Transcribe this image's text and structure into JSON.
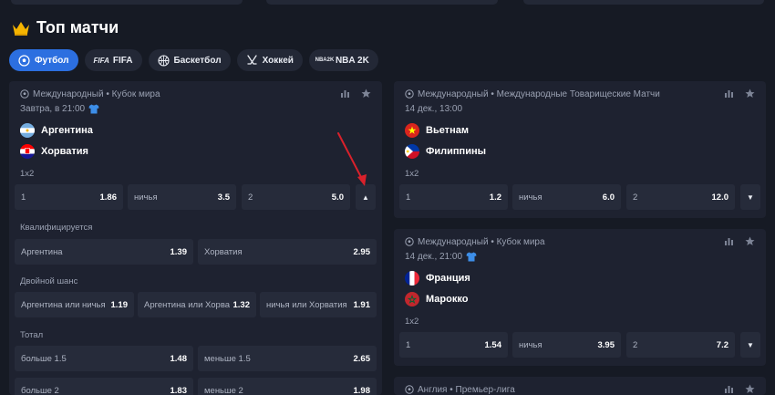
{
  "page": {
    "title": "Топ матчи"
  },
  "sport_tabs": [
    {
      "label": "Футбол",
      "icon": "soccer-ball-icon",
      "active": true
    },
    {
      "label": "FIFA",
      "icon": "fifa-logo-icon",
      "icon_text": "FIFA",
      "active": false
    },
    {
      "label": "Баскетбол",
      "icon": "basketball-icon",
      "active": false
    },
    {
      "label": "Хоккей",
      "icon": "hockey-sticks-icon",
      "active": false
    },
    {
      "label": "NBA 2K",
      "icon": "nba2k-logo-icon",
      "icon_text_1": "NBA",
      "icon_text_2": "2K",
      "active": false
    }
  ],
  "match1": {
    "league": "Международный • Кубок мира",
    "when": "Завтра, в 21:00",
    "team1": "Аргентина",
    "team2": "Хорватия",
    "m1x2": {
      "title": "1x2",
      "o1": {
        "label": "1",
        "value": "1.86"
      },
      "ox": {
        "label": "ничья",
        "value": "3.5"
      },
      "o2": {
        "label": "2",
        "value": "5.0"
      }
    },
    "qual": {
      "title": "Квалифицируется",
      "o1": {
        "label": "Аргентина",
        "value": "1.39"
      },
      "o2": {
        "label": "Хорватия",
        "value": "2.95"
      }
    },
    "dc": {
      "title": "Двойной шанс",
      "o1": {
        "label": "Аргентина или ничья",
        "value": "1.19"
      },
      "o2": {
        "label": "Аргентина или Хорватия",
        "value": "1.32"
      },
      "o3": {
        "label": "ничья или Хорватия",
        "value": "1.91"
      }
    },
    "total": {
      "title": "Тотал",
      "r1a": {
        "label": "больше 1.5",
        "value": "1.48"
      },
      "r1b": {
        "label": "меньше 1.5",
        "value": "2.65"
      },
      "r2a": {
        "label": "больше 2",
        "value": "1.83"
      },
      "r2b": {
        "label": "меньше 2",
        "value": "1.98"
      }
    }
  },
  "match2": {
    "league": "Международный • Международные Товарищеские Матчи",
    "when": "14 дек., 13:00",
    "team1": "Вьетнам",
    "team2": "Филиппины",
    "m1x2": {
      "title": "1x2",
      "o1": {
        "label": "1",
        "value": "1.2"
      },
      "ox": {
        "label": "ничья",
        "value": "6.0"
      },
      "o2": {
        "label": "2",
        "value": "12.0"
      }
    }
  },
  "match3": {
    "league": "Международный • Кубок мира",
    "when": "14 дек., 21:00",
    "team1": "Франция",
    "team2": "Марокко",
    "m1x2": {
      "title": "1x2",
      "o1": {
        "label": "1",
        "value": "1.54"
      },
      "ox": {
        "label": "ничья",
        "value": "3.95"
      },
      "o2": {
        "label": "2",
        "value": "7.2"
      }
    }
  },
  "match4": {
    "league": "Англия • Премьер-лига"
  },
  "colors": {
    "accent": "#2c6fe0",
    "background": "#161a24",
    "card": "#1e2230",
    "cell": "#262b3a",
    "annotation_arrow": "#d9212b"
  }
}
